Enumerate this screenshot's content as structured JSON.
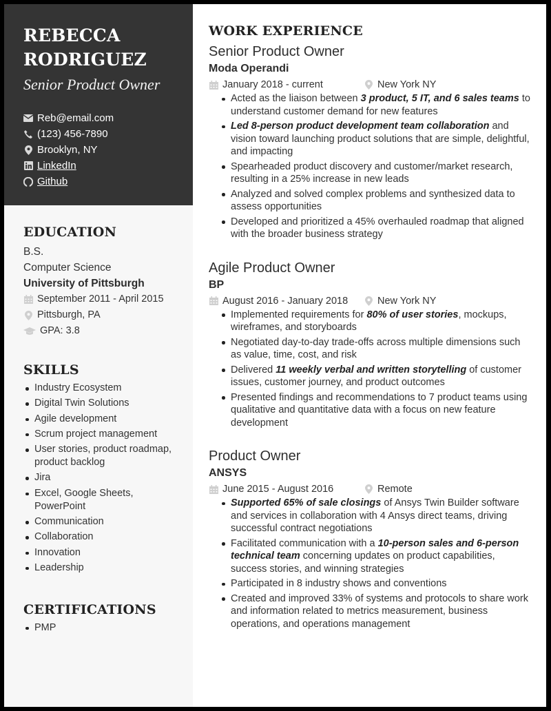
{
  "profile": {
    "first_name": "REBECCA",
    "last_name": "RODRIGUEZ",
    "title": "Senior Product Owner"
  },
  "contacts": [
    {
      "icon": "envelope-icon",
      "text": "Reb@email.com",
      "link": false
    },
    {
      "icon": "phone-icon",
      "text": "(123) 456-7890",
      "link": false
    },
    {
      "icon": "map-pin-icon",
      "text": "Brooklyn, NY",
      "link": false
    },
    {
      "icon": "linkedin-icon",
      "text": "LinkedIn",
      "link": true
    },
    {
      "icon": "github-icon",
      "text": "Github",
      "link": true
    }
  ],
  "education": {
    "heading": "EDUCATION",
    "degree": "B.S.",
    "field": "Computer Science",
    "school": "University of Pittsburgh",
    "dates": "September 2011 - April 2015",
    "location": "Pittsburgh, PA",
    "gpa": "GPA: 3.8"
  },
  "skills": {
    "heading": "SKILLS",
    "items": [
      "Industry Ecosystem",
      "Digital Twin Solutions",
      "Agile development",
      "Scrum project management",
      "User stories, product roadmap, product backlog",
      "Jira",
      "Excel, Google Sheets, PowerPoint",
      "Communication",
      "Collaboration",
      "Innovation",
      "Leadership"
    ]
  },
  "certifications": {
    "heading": "CERTIFICATIONS",
    "items": [
      "PMP"
    ]
  },
  "work": {
    "heading": "WORK EXPERIENCE",
    "jobs": [
      {
        "title": "Senior Product Owner",
        "company": "Moda Operandi",
        "dates": "January 2018 - current",
        "location": "New York NY",
        "bullets": [
          [
            {
              "t": "Acted as the liaison between "
            },
            {
              "t": "3 product, 5 IT, and 6 sales teams",
              "em": true
            },
            {
              "t": " to understand customer demand for new features"
            }
          ],
          [
            {
              "t": "Led 8-person product development team collaboration",
              "em": true
            },
            {
              "t": " and vision toward launching product solutions that are simple, delightful, and impacting"
            }
          ],
          [
            {
              "t": "Spearheaded product discovery and customer/market research, resulting in a 25% increase in new leads"
            }
          ],
          [
            {
              "t": "Analyzed and solved complex problems and synthesized data to assess opportunities"
            }
          ],
          [
            {
              "t": "Developed and prioritized a 45% overhauled roadmap that aligned with the broader business strategy"
            }
          ]
        ]
      },
      {
        "title": "Agile Product Owner",
        "company": "BP",
        "dates": "August 2016 - January 2018",
        "location": "New York NY",
        "bullets": [
          [
            {
              "t": "Implemented requirements for "
            },
            {
              "t": "80% of user stories",
              "em": true
            },
            {
              "t": ", mockups, wireframes, and storyboards"
            }
          ],
          [
            {
              "t": "Negotiated day-to-day trade-offs across multiple dimensions such as value, time, cost, and risk"
            }
          ],
          [
            {
              "t": "Delivered "
            },
            {
              "t": "11 weekly verbal and written storytelling",
              "em": true
            },
            {
              "t": " of customer issues, customer journey, and product outcomes"
            }
          ],
          [
            {
              "t": "Presented findings and recommendations to 7 product teams using qualitative and quantitative data with a focus on new feature development"
            }
          ]
        ]
      },
      {
        "title": "Product Owner",
        "company": "ANSYS",
        "dates": "June 2015 - August 2016",
        "location": "Remote",
        "bullets": [
          [
            {
              "t": "Supported 65% of sale closings",
              "em": true
            },
            {
              "t": " of Ansys Twin Builder software and services in collaboration with 4 Ansys direct teams, driving successful contract negotiations"
            }
          ],
          [
            {
              "t": "Facilitated communication with a "
            },
            {
              "t": "10-person sales and 6-person technical team",
              "em": true
            },
            {
              "t": " concerning updates on product capabilities, success stories, and winning strategies"
            }
          ],
          [
            {
              "t": "Participated in 8 industry shows and conventions"
            }
          ],
          [
            {
              "t": "Created and improved 33% of systems and protocols to share work and information related to metrics measurement, business operations, and operations management"
            }
          ]
        ]
      }
    ]
  },
  "colors": {
    "header_bg": "#343434",
    "sidebar_bg": "#f7f7f7",
    "icon_gray": "#bdbdbd",
    "text": "#2e2e2e"
  }
}
